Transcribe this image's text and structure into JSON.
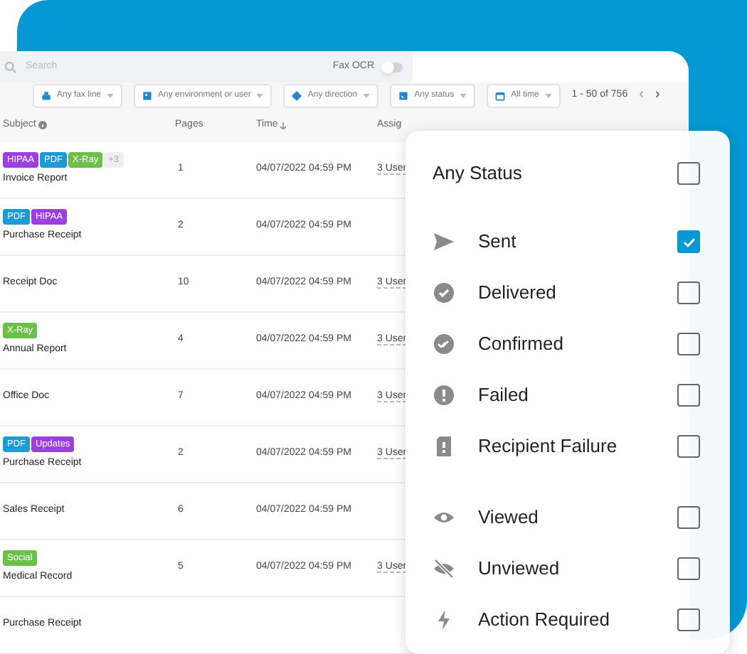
{
  "search": {
    "placeholder": "Search"
  },
  "fax_ocr": {
    "label": "Fax OCR",
    "on": false
  },
  "filters": [
    {
      "label": "Any fax line",
      "kind": "fax"
    },
    {
      "label": "Any environment or user",
      "kind": "env"
    },
    {
      "label": "Any direction",
      "kind": "direction"
    },
    {
      "label": "Any status",
      "kind": "status"
    },
    {
      "label": "All time",
      "kind": "time"
    }
  ],
  "pagination": {
    "range": "1 - 50 of 756",
    "prev": "‹",
    "next": "›"
  },
  "table": {
    "columns": [
      "Subject",
      "Pages",
      "Time",
      "Assig"
    ],
    "rows": [
      {
        "tags": [
          {
            "label": "HIPAA",
            "color": "#9b3fe0"
          },
          {
            "label": "PDF",
            "color": "#1e9bd7"
          },
          {
            "label": "X-Ray",
            "color": "#6cc04a"
          },
          {
            "label": "+3",
            "color": "#eeeeee"
          }
        ],
        "subject": "Invoice Report",
        "pages": "1",
        "time": "04/07/2022 04:59 PM",
        "assigned": "3 User"
      },
      {
        "tags": [
          {
            "label": "PDF",
            "color": "#1e9bd7"
          },
          {
            "label": "HIPAA",
            "color": "#9b3fe0"
          }
        ],
        "subject": "Purchase Receipt",
        "pages": "2",
        "time": "04/07/2022 04:59 PM"
      },
      {
        "subject": "Receipt Doc",
        "pages": "10",
        "time": "04/07/2022 04:59 PM",
        "assigned": "3 User"
      },
      {
        "tags": [
          {
            "label": "X-Ray",
            "color": "#6cc04a"
          }
        ],
        "subject": "Annual Report",
        "pages": "4",
        "time": "04/07/2022 04:59 PM",
        "assigned": "3 User"
      },
      {
        "subject": "Office Doc",
        "pages": "7",
        "time": "04/07/2022 04:59 PM",
        "assigned": "3 User"
      },
      {
        "tags": [
          {
            "label": "PDF",
            "color": "#1e9bd7"
          },
          {
            "label": "Updates",
            "color": "#9b3fe0"
          }
        ],
        "subject": "Purchase Receipt",
        "pages": "2",
        "time": "04/07/2022 04:59 PM",
        "assigned": "3 User"
      },
      {
        "subject": "Sales Receipt",
        "pages": "6",
        "time": "04/07/2022 04:59 PM"
      },
      {
        "tags": [
          {
            "label": "Social",
            "color": "#6cc04a"
          }
        ],
        "subject": "Medical Record",
        "pages": "5",
        "time": "04/07/2022 04:59 PM",
        "assigned": "3 User"
      },
      {
        "subject": "Purchase Receipt"
      }
    ]
  },
  "status_menu": {
    "any": {
      "label": "Any Status",
      "checked": false
    },
    "items": [
      {
        "label": "Sent",
        "kind": "sent",
        "checked": true
      },
      {
        "label": "Delivered",
        "kind": "delivered",
        "checked": false
      },
      {
        "label": "Confirmed",
        "kind": "confirmed",
        "checked": false
      },
      {
        "label": "Failed",
        "kind": "failed",
        "checked": false
      },
      {
        "label": "Recipient Failure",
        "kind": "recipient_failure",
        "checked": false
      },
      {
        "label": "Viewed",
        "kind": "viewed",
        "checked": false,
        "gap": true
      },
      {
        "label": "Unviewed",
        "kind": "unviewed",
        "checked": false
      },
      {
        "label": "Action Required",
        "kind": "action",
        "checked": false
      }
    ]
  }
}
